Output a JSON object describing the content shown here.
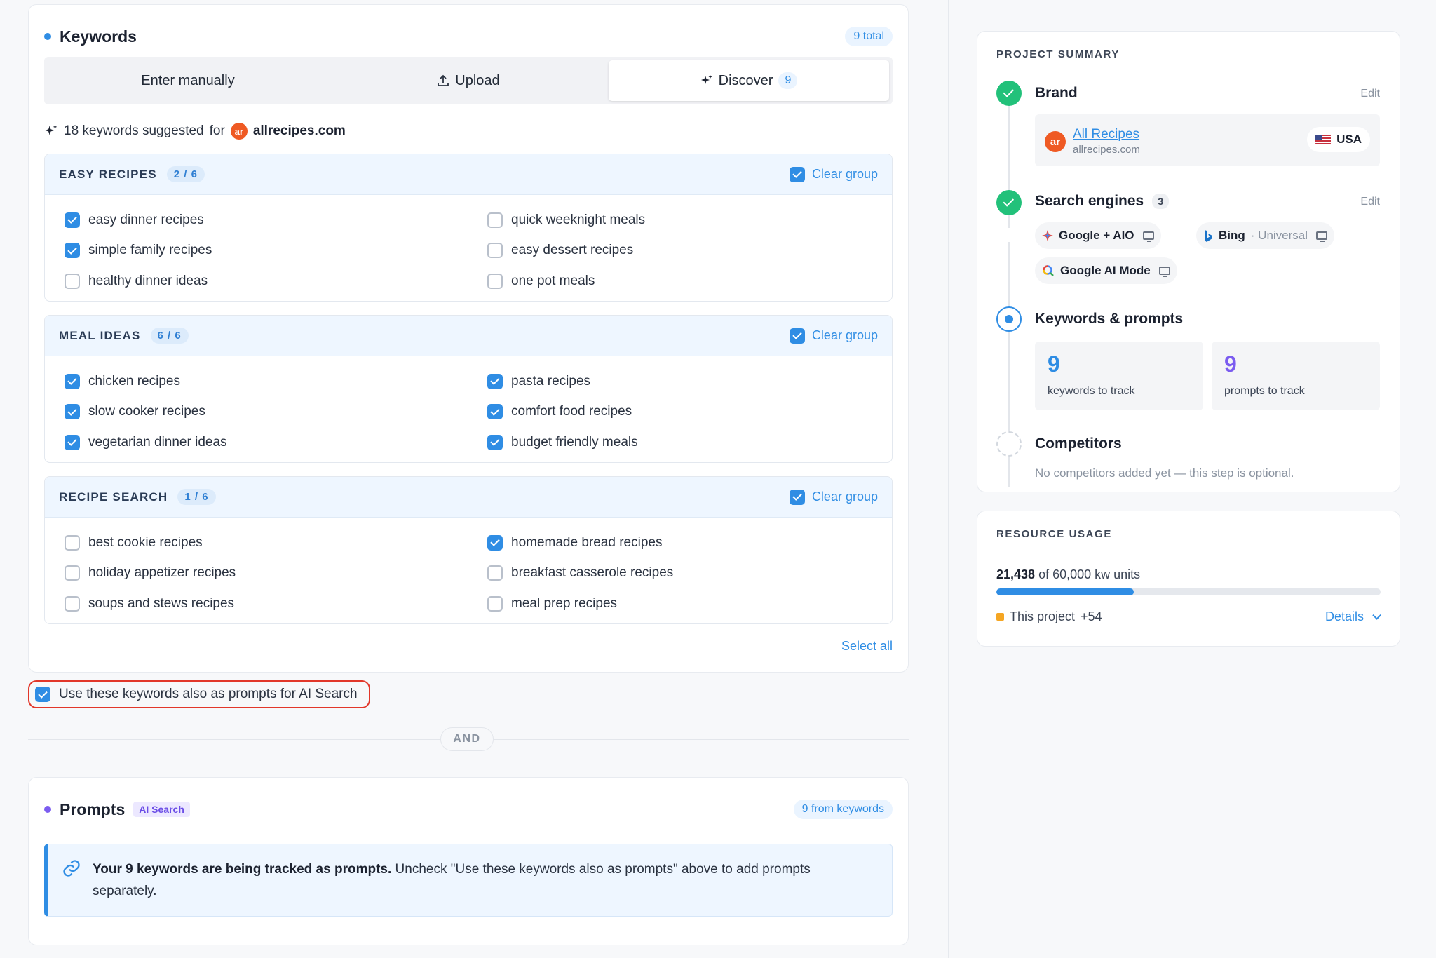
{
  "keywords": {
    "title": "Keywords",
    "total": "9 total",
    "tabs": [
      {
        "label": "Enter manually",
        "icon": ""
      },
      {
        "label": "Upload",
        "icon": "upload-icon"
      },
      {
        "label": "Discover",
        "icon": "sparkle-icon",
        "count": "9"
      }
    ],
    "suggest_prefix": "18 keywords suggested",
    "suggest_for": "for",
    "brand_logo_text": "ar",
    "domain": "allrecipes.com",
    "groups": [
      {
        "title": "EASY RECIPES",
        "count": "2 / 6",
        "clear": "Clear group",
        "items": [
          {
            "label": "easy dinner recipes",
            "checked": true
          },
          {
            "label": "quick weeknight meals",
            "checked": false
          },
          {
            "label": "simple family recipes",
            "checked": true
          },
          {
            "label": "easy dessert recipes",
            "checked": false
          },
          {
            "label": "healthy dinner ideas",
            "checked": false
          },
          {
            "label": "one pot meals",
            "checked": false
          }
        ]
      },
      {
        "title": "MEAL IDEAS",
        "count": "6 / 6",
        "clear": "Clear group",
        "items": [
          {
            "label": "chicken recipes",
            "checked": true
          },
          {
            "label": "pasta recipes",
            "checked": true
          },
          {
            "label": "slow cooker recipes",
            "checked": true
          },
          {
            "label": "comfort food recipes",
            "checked": true
          },
          {
            "label": "vegetarian dinner ideas",
            "checked": true
          },
          {
            "label": "budget friendly meals",
            "checked": true
          }
        ]
      },
      {
        "title": "RECIPE SEARCH",
        "count": "1 / 6",
        "clear": "Clear group",
        "items": [
          {
            "label": "best cookie recipes",
            "checked": false
          },
          {
            "label": "homemade bread recipes",
            "checked": true
          },
          {
            "label": "holiday appetizer recipes",
            "checked": false
          },
          {
            "label": "breakfast casserole recipes",
            "checked": false
          },
          {
            "label": "soups and stews recipes",
            "checked": false
          },
          {
            "label": "meal prep recipes",
            "checked": false
          }
        ]
      }
    ],
    "select_all": "Select all"
  },
  "ai_option": {
    "label": "Use these keywords also as prompts for AI Search",
    "checked": true
  },
  "and_label": "AND",
  "prompts": {
    "title": "Prompts",
    "badge": "AI Search",
    "from": "9 from keywords",
    "info_bold": "Your 9 keywords are being tracked as prompts.",
    "info_rest": " Uncheck \"Use these keywords also as prompts\" above to add prompts separately."
  },
  "summary": {
    "label": "PROJECT SUMMARY",
    "brand": {
      "title": "Brand",
      "edit": "Edit",
      "logo_text": "ar",
      "name": "All Recipes",
      "url": "allrecipes.com",
      "country": "USA"
    },
    "engines": {
      "title": "Search engines",
      "count": "3",
      "edit": "Edit",
      "items": [
        {
          "name": "Google + AIO",
          "extra": ""
        },
        {
          "name": "Bing",
          "extra": "· Universal"
        },
        {
          "name": "Google AI Mode",
          "extra": ""
        }
      ]
    },
    "keywords_prompts": {
      "title": "Keywords & prompts",
      "keywords_num": "9",
      "keywords_label": "keywords to track",
      "prompts_num": "9",
      "prompts_label": "prompts to track"
    },
    "competitors": {
      "title": "Competitors",
      "note": "No competitors added yet — this step is optional."
    }
  },
  "resource": {
    "label": "RESOURCE USAGE",
    "used": "21,438",
    "of_text": "of 60,000 kw units",
    "progress": 0.357,
    "legend": "This project",
    "delta": "+54",
    "details": "Details"
  },
  "colors": {
    "accent": "#2f8de4",
    "success": "#22c17a",
    "prompt_num": "#7b5cf0",
    "legend": "#f5a623",
    "highlight": "#e2372a"
  }
}
